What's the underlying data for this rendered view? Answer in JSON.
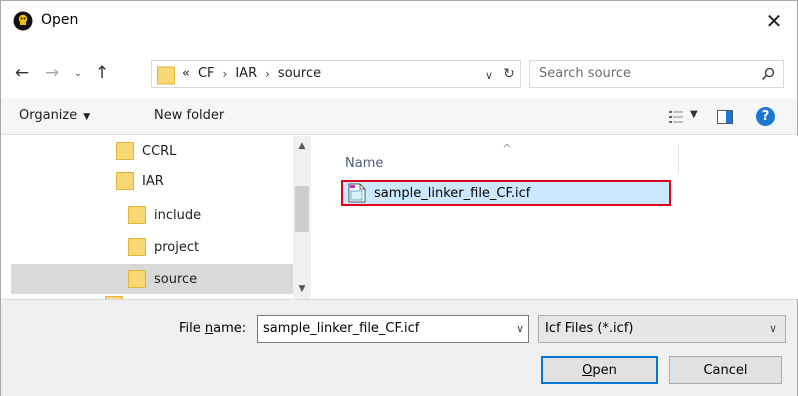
{
  "window": {
    "title": "Open",
    "close_glyph": "✕"
  },
  "address": {
    "overflow": "«",
    "crumbs": [
      "CF",
      "IAR",
      "source"
    ],
    "separator": "›",
    "search_placeholder": "Search source"
  },
  "toolbar": {
    "organize_label": "Organize",
    "new_folder_label": "New folder",
    "help_glyph": "?"
  },
  "tree": {
    "items": [
      {
        "label": "CCRL",
        "level": 1
      },
      {
        "label": "IAR",
        "level": 1
      },
      {
        "label": "include",
        "level": 2
      },
      {
        "label": "project",
        "level": 2
      },
      {
        "label": "source",
        "level": 2,
        "selected": true
      }
    ]
  },
  "content": {
    "column_name": "Name",
    "files": [
      {
        "name": "sample_linker_file_CF.icf",
        "selected": true
      }
    ]
  },
  "footer": {
    "file_name_label_pre": "File ",
    "file_name_label_accel": "n",
    "file_name_label_post": "ame:",
    "file_name_value": "sample_linker_file_CF.icf",
    "file_type_value": "Icf Files (*.icf)",
    "open_label": "Open",
    "open_accel": "O",
    "open_rest": "pen",
    "cancel_label": "Cancel"
  },
  "colors": {
    "selection": "#cce8ff",
    "highlight_border": "#e0001b",
    "accent": "#0078d7"
  }
}
